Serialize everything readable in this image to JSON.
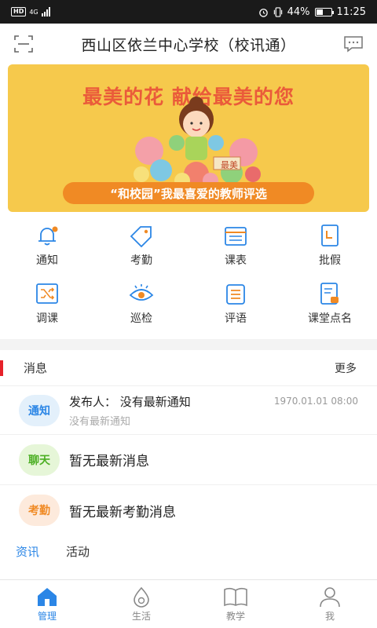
{
  "status_bar": {
    "hd": "HD",
    "network": "4G",
    "battery": "44%",
    "battery_level": 0.44,
    "time": "11:25"
  },
  "header": {
    "title": "西山区依兰中心学校（校讯通）",
    "scan_icon": "scan-icon",
    "message_icon": "chat-bubble-icon"
  },
  "banner": {
    "headline": "最美的花  献给最美的您",
    "footer": "“和校园”我最喜爱的教师评选",
    "badge": "最美"
  },
  "functions": [
    {
      "label": "通知",
      "icon": "bell-icon"
    },
    {
      "label": "考勤",
      "icon": "tag-icon"
    },
    {
      "label": "课表",
      "icon": "calendar-icon"
    },
    {
      "label": "批假",
      "icon": "leave-icon"
    },
    {
      "label": "调课",
      "icon": "shuffle-icon"
    },
    {
      "label": "巡检",
      "icon": "eye-icon"
    },
    {
      "label": "评语",
      "icon": "comment-list-icon"
    },
    {
      "label": "课堂点名",
      "icon": "rollcall-icon"
    }
  ],
  "messages": {
    "title": "消息",
    "more": "更多",
    "notice": {
      "badge": "通知",
      "sender": "发布人： 没有最新通知",
      "time": "1970.01.01 08:00",
      "preview": "没有最新通知"
    },
    "chat": {
      "badge": "聊天",
      "text": "暂无最新消息"
    },
    "attendance": {
      "badge": "考勤",
      "text": "暂无最新考勤消息"
    }
  },
  "info_tabs": [
    "资讯",
    "活动"
  ],
  "bottom_nav": [
    {
      "label": "管理",
      "icon": "home-icon",
      "active": true
    },
    {
      "label": "生活",
      "icon": "drop-icon",
      "active": false
    },
    {
      "label": "教学",
      "icon": "book-icon",
      "active": false
    },
    {
      "label": "我",
      "icon": "person-icon",
      "active": false
    }
  ],
  "colors": {
    "accent": "#2b86e6",
    "banner_bg": "#f6c94c",
    "headline": "#ea5b3a",
    "marker": "#e6212a"
  }
}
